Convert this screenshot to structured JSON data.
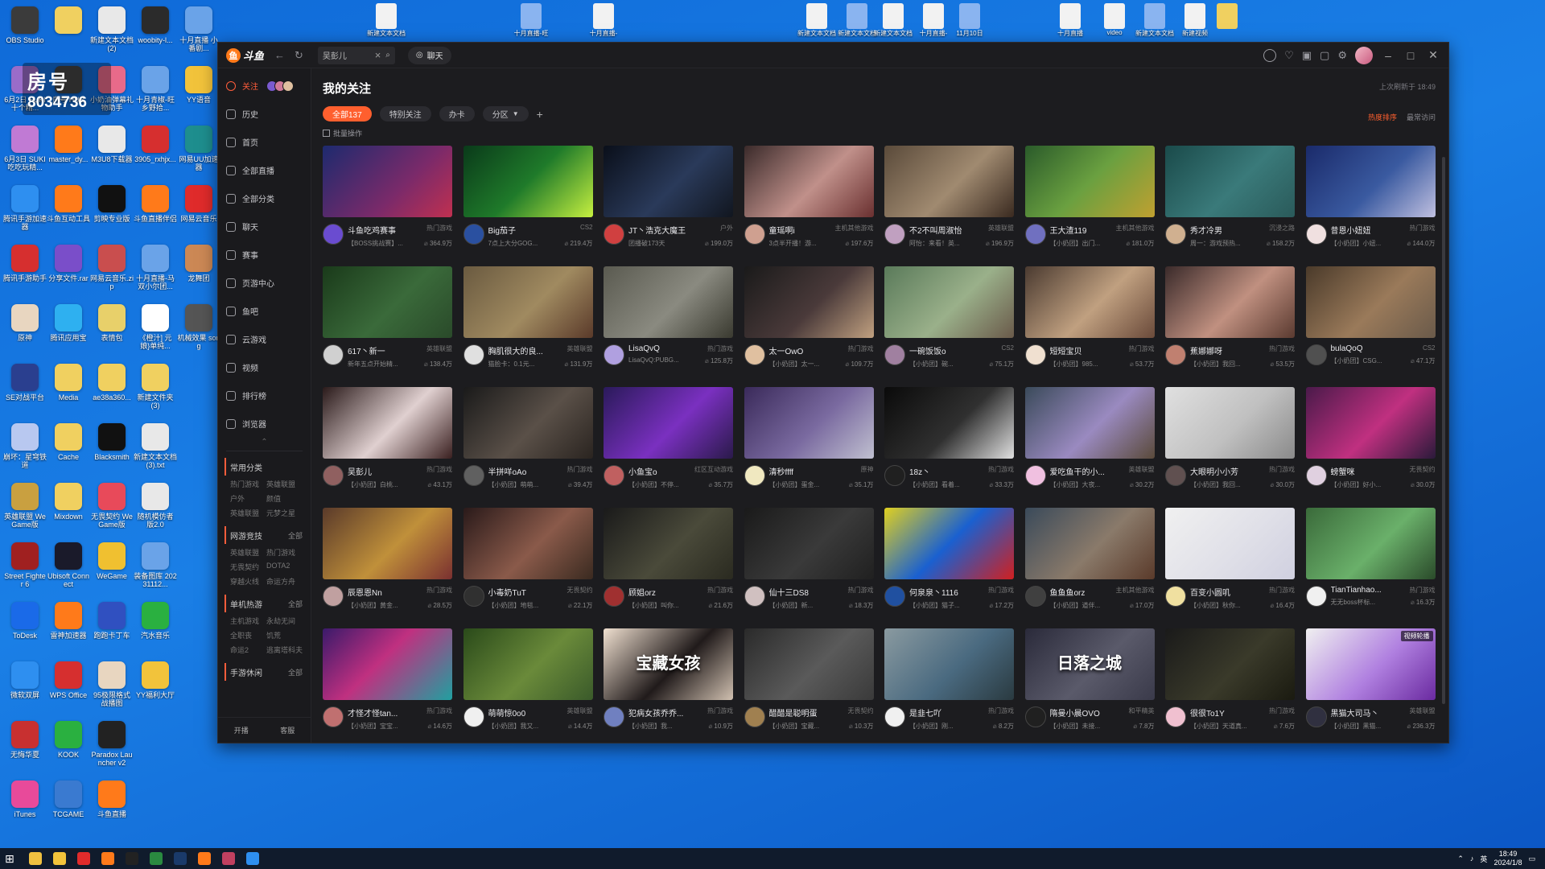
{
  "watermark": {
    "title": "房号",
    "number": "8034736"
  },
  "desktop_icons": [
    {
      "label": "OBS Studio",
      "color": "#3b3b3b"
    },
    {
      "label": "",
      "color": "#f0d060"
    },
    {
      "label": "新建文本文档 (2)",
      "color": "#e8e8e8"
    },
    {
      "label": "woobity-l...",
      "color": "#2b2b2b"
    },
    {
      "label": "十月直播 小番剧...",
      "color": "#6aa3e8"
    },
    {
      "label": "6月2日 SUKI十个精...",
      "color": "#9a6cc9"
    },
    {
      "label": "房号 HUB",
      "color": "#444"
    },
    {
      "label": "小奶油弹幕礼物助手",
      "color": "#e86a8a"
    },
    {
      "label": "十月青椒-旺 乡野拾...",
      "color": "#6aa3e8"
    },
    {
      "label": "YY语音",
      "color": "#f2c33b"
    },
    {
      "label": "6月3日 SUKI 吃吃玩精...",
      "color": "#c07ad4"
    },
    {
      "label": "master_dy...",
      "color": "#ff7a1a"
    },
    {
      "label": "M3U8下载器",
      "color": "#e8e8e8"
    },
    {
      "label": "3905_rxhjx...",
      "color": "#d62f2f"
    },
    {
      "label": "网易UU加速器",
      "color": "#1e8e8e"
    },
    {
      "label": "腾讯手游加速器",
      "color": "#2e8ff0"
    },
    {
      "label": "斗鱼互动工具",
      "color": "#ff7a1a"
    },
    {
      "label": "剪映专业版",
      "color": "#111"
    },
    {
      "label": "斗鱼直播伴侣",
      "color": "#ff7a1a"
    },
    {
      "label": "网易云音乐",
      "color": "#e02b2b"
    },
    {
      "label": "腾讯手游助手",
      "color": "#d62f2f"
    },
    {
      "label": "分享文件.rar",
      "color": "#7a4ec9"
    },
    {
      "label": "网易云音乐.zip",
      "color": "#c94e4e"
    },
    {
      "label": "十月直播-马双小尔团...",
      "color": "#6aa3e8"
    },
    {
      "label": "龙舞团",
      "color": "#cc8855"
    },
    {
      "label": "原神",
      "color": "#e8d6c0"
    },
    {
      "label": "腾讯应用宝",
      "color": "#2eb0f0"
    },
    {
      "label": "表情包",
      "color": "#e8d06a"
    },
    {
      "label": "《橙汁] 元 娘}单纯...",
      "color": "#fff"
    },
    {
      "label": "机械效果 song",
      "color": "#555"
    },
    {
      "label": "SE对战平台",
      "color": "#2a3f8f"
    },
    {
      "label": "Media",
      "color": "#f0d060"
    },
    {
      "label": "ae38a360...",
      "color": "#f0d060"
    },
    {
      "label": "新建文件夹 (3)",
      "color": "#f0d060"
    },
    {
      "label": "",
      "color": "transparent"
    },
    {
      "label": "崩坏：星穹铁道",
      "color": "#b8c8f0"
    },
    {
      "label": "Cache",
      "color": "#f0d060"
    },
    {
      "label": "Blacksmith",
      "color": "#111"
    },
    {
      "label": "新建文本文档 (3).txt",
      "color": "#e8e8e8"
    },
    {
      "label": "",
      "color": "transparent"
    },
    {
      "label": "英雄联盟 WeGame版",
      "color": "#c9a040"
    },
    {
      "label": "Mixdown",
      "color": "#f0d060"
    },
    {
      "label": "无畏契约 WeGame版",
      "color": "#e84a5a"
    },
    {
      "label": "随机模仿者 版2.0",
      "color": "#e8e8e8"
    },
    {
      "label": "",
      "color": "transparent"
    },
    {
      "label": "Street Fighter 6",
      "color": "#a02020"
    },
    {
      "label": "Ubisoft Connect",
      "color": "#1a1a2a"
    },
    {
      "label": "WeGame",
      "color": "#f0c030"
    },
    {
      "label": "装备图库 20231112...",
      "color": "#6aa3e8"
    },
    {
      "label": "",
      "color": "transparent"
    },
    {
      "label": "ToDesk",
      "color": "#1a6ae8"
    },
    {
      "label": "雷神加速器",
      "color": "#ff7a1a"
    },
    {
      "label": "跑跑卡丁车",
      "color": "#3050c0"
    },
    {
      "label": "汽水音乐",
      "color": "#2ab040"
    },
    {
      "label": "",
      "color": "transparent"
    },
    {
      "label": "微软双屏",
      "color": "#2e8ff0"
    },
    {
      "label": "WPS Office",
      "color": "#d62f2f"
    },
    {
      "label": "95极限格式战播图",
      "color": "#e8d6c0"
    },
    {
      "label": "YY福利大厅",
      "color": "#f2c33b"
    },
    {
      "label": "",
      "color": "transparent"
    },
    {
      "label": "无悔华夏",
      "color": "#c83030"
    },
    {
      "label": "KOOK",
      "color": "#2ab040"
    },
    {
      "label": "Paradox Launcher v2",
      "color": "#222"
    },
    {
      "label": "",
      "color": "transparent"
    },
    {
      "label": "",
      "color": "transparent"
    },
    {
      "label": "iTunes",
      "color": "#e84a9a"
    },
    {
      "label": "TCGAME",
      "color": "#3a7ad0"
    },
    {
      "label": "斗鱼直播",
      "color": "#ff7a1a"
    }
  ],
  "desktop_top_icons": [
    {
      "label": "新建文本文档"
    },
    {
      "label": "十月直播-旺"
    },
    {
      "label": "十月直播-"
    },
    {
      "label": "新建文本文档"
    },
    {
      "label": "新建文本文档"
    },
    {
      "label": "新建文本文档"
    },
    {
      "label": "十月直播-"
    },
    {
      "label": "11月10日"
    },
    {
      "label": "十月直播"
    },
    {
      "label": "video"
    },
    {
      "label": "新建文本文档"
    },
    {
      "label": "新建视频"
    },
    {
      "label": ""
    }
  ],
  "app": {
    "logo_text": "斗鱼",
    "search_value": "吴彭儿",
    "chat_label": "聊天",
    "page_title": "我的关注",
    "last_refresh": "上次刷新于 18:49",
    "batch_label": "批量操作",
    "sort_hot": "热度排序",
    "sort_recent": "最常访问",
    "filters": [
      {
        "label": "全部137",
        "active": true
      },
      {
        "label": "特别关注",
        "active": false
      },
      {
        "label": "办卡",
        "active": false
      },
      {
        "label": "分区",
        "active": false,
        "caret": true
      }
    ]
  },
  "sidebar": {
    "items": [
      {
        "label": "关注",
        "active": true
      },
      {
        "label": "历史"
      },
      {
        "label": "首页"
      },
      {
        "label": "全部直播"
      },
      {
        "label": "全部分类"
      },
      {
        "label": "聊天"
      },
      {
        "label": "赛事"
      },
      {
        "label": "页游中心"
      },
      {
        "label": "鱼吧"
      },
      {
        "label": "云游戏"
      },
      {
        "label": "视频"
      },
      {
        "label": "排行榜"
      },
      {
        "label": "浏览器"
      }
    ],
    "sections": [
      {
        "title": "常用分类",
        "more": "",
        "subs": [
          "热门游戏",
          "英雄联盟",
          "户外",
          "颜值",
          "英雄联盟",
          "元梦之星"
        ]
      },
      {
        "title": "网游竞技",
        "more": "全部",
        "subs": [
          "英雄联盟",
          "热门游戏",
          "无畏契约",
          "DOTA2",
          "穿越火线",
          "命运方舟"
        ]
      },
      {
        "title": "单机热游",
        "more": "全部",
        "subs": [
          "主机游戏",
          "永劫无间",
          "全职丧",
          "饥荒",
          "命运2",
          "逃离塔科夫"
        ]
      },
      {
        "title": "手游休闲",
        "more": "全部",
        "subs": []
      }
    ],
    "bottom_left": "开播",
    "bottom_right": "客服"
  },
  "cards": [
    {
      "name": "斗鱼吃鸡赛事",
      "cat": "热门游戏",
      "desc": "【BOSS挑战赛】...",
      "views": "364.9万",
      "bg": "linear-gradient(135deg,#1d2a6e,#7a2a6a 60%,#c03050)",
      "av": "#6a4cd0"
    },
    {
      "name": "Big茄子",
      "cat": "CS2",
      "desc": "7点上大分GOG...",
      "views": "219.4万",
      "bg": "linear-gradient(135deg,#0a3a1a,#1f7a2a 50%,#c6f040)",
      "av": "#2a50a0"
    },
    {
      "name": "JT丶浩克大魔王",
      "cat": "户外",
      "desc": "团播破173天",
      "views": "199.0万",
      "bg": "linear-gradient(135deg,#0a0f1a,#2a3a5a 55%,#11161f)",
      "av": "#d04040"
    },
    {
      "name": "童瑶啊i",
      "cat": "主机其他游戏",
      "desc": "3点半开播！游...",
      "views": "197.6万",
      "bg": "linear-gradient(135deg,#3a2a2a,#c0908a 55%,#6a3030)",
      "av": "#cfa090"
    },
    {
      "name": "不2不叫周淑怡",
      "cat": "英雄联盟",
      "desc": "阿怡：来看！英...",
      "views": "196.9万",
      "bg": "linear-gradient(135deg,#5a4a3a,#a08a70 55%,#3a2a20)",
      "av": "#c0a0c0"
    },
    {
      "name": "王大渣119",
      "cat": "主机其他游戏",
      "desc": "【小奶团】出门...",
      "views": "181.0万",
      "bg": "linear-gradient(135deg,#2a5a2a,#6aa040 50%,#c0a030)",
      "av": "#7070c0"
    },
    {
      "name": "秀才冷男",
      "cat": "沉浸之路",
      "desc": "周一：游戏预热...",
      "views": "158.2万",
      "bg": "linear-gradient(135deg,#1a4a4a,#3a7a7a 55%,#2a5a5a)",
      "av": "#d0b090"
    },
    {
      "name": "昔恩小妞妞",
      "cat": "热门游戏",
      "desc": "【小奶团】小妞...",
      "views": "144.0万",
      "bg": "linear-gradient(135deg,#1a2a6a,#3a5aa0 55%,#c0c0e0)",
      "av": "#f0e0e0"
    },
    {
      "name": "617丶新一",
      "cat": "英雄联盟",
      "desc": "新年五点开始精...",
      "views": "138.4万",
      "bg": "linear-gradient(135deg,#1a3a1a,#3a6a3a 55%,#2a4a2a)",
      "av": "#d0d0d0"
    },
    {
      "name": "胸肌很大的良...",
      "cat": "英雄联盟",
      "desc": "猫脸卡：0.1元...",
      "views": "131.9万",
      "bg": "linear-gradient(135deg,#6a5a40,#a08a60 55%,#5a3a2a)",
      "av": "#e0e0e0"
    },
    {
      "name": "LisaQvQ",
      "cat": "热门游戏",
      "desc": "LisaQvQ:PUBG...",
      "views": "125.8万",
      "bg": "linear-gradient(135deg,#5a5a50,#8a8a80 55%,#3a3a30)",
      "av": "#b0a0e0"
    },
    {
      "name": "太一OwO",
      "cat": "热门游戏",
      "desc": "【小奶团】太一...",
      "views": "109.7万",
      "bg": "linear-gradient(135deg,#1a1a1a,#4a3a3a 55%,#c0a080)",
      "av": "#e0c0a0"
    },
    {
      "name": "一碗饭饭o",
      "cat": "CS2",
      "desc": "【小奶团】碗...",
      "views": "75.1万",
      "bg": "linear-gradient(135deg,#5a7a5a,#9ab08a 55%,#6a5a4a)",
      "av": "#a080a0"
    },
    {
      "name": "短短宝贝",
      "cat": "热门游戏",
      "desc": "【小奶团】985...",
      "views": "53.7万",
      "bg": "linear-gradient(135deg,#4a3a30,#c0a080 55%,#6a4a3a)",
      "av": "#f0e0d0"
    },
    {
      "name": "蕉娜娜呀",
      "cat": "热门游戏",
      "desc": "【小奶团】我回...",
      "views": "53.5万",
      "bg": "linear-gradient(135deg,#3a2a2a,#c09080 55%,#5a3a30)",
      "av": "#c08070"
    },
    {
      "name": "bulaQoQ",
      "cat": "CS2",
      "desc": "【小奶团】CSG...",
      "views": "47.1万",
      "bg": "linear-gradient(135deg,#4a3a2a,#9a7a5a 55%,#6a5a4a)",
      "av": "#505050"
    },
    {
      "name": "吴彭儿",
      "cat": "热门游戏",
      "desc": "【小奶团】白桃...",
      "views": "43.1万",
      "bg": "linear-gradient(135deg,#2a1a1a,#e0d0d0 55%,#3a2020)",
      "av": "#906060"
    },
    {
      "name": "半拼咩oAo",
      "cat": "热门游戏",
      "desc": "【小奶团】萌萌...",
      "views": "39.4万",
      "bg": "linear-gradient(135deg,#1a1a1a,#5a5048 55%,#2a2420)",
      "av": "#606060"
    },
    {
      "name": "小鱼宝o",
      "cat": "红区互动游戏",
      "desc": "【小奶团】不停...",
      "views": "35.7万",
      "bg": "linear-gradient(135deg,#2a1a5a,#7a30c0 55%,#2a1a4a)",
      "av": "#c06060"
    },
    {
      "name": "清秒ffff",
      "cat": "原神",
      "desc": "【小奶团】蛋金...",
      "views": "35.1万",
      "bg": "linear-gradient(135deg,#3a2a5a,#7a6aa0 55%,#c0c0d0)",
      "av": "#f0e8c0"
    },
    {
      "name": "18z丶",
      "cat": "热门游戏",
      "desc": "【小奶团】看着...",
      "views": "33.3万",
      "bg": "linear-gradient(135deg,#0a0a0a,#303030 55%,#e0e0e0)",
      "av": "#202020"
    },
    {
      "name": "爱吃鱼干的小...",
      "cat": "英雄联盟",
      "desc": "【小奶团】大夜...",
      "views": "30.2万",
      "bg": "linear-gradient(135deg,#3a4a5a,#9a8ac0 55%,#5a4a3a)",
      "av": "#f0c0e0"
    },
    {
      "name": "大眼明小小芳",
      "cat": "热门游戏",
      "desc": "【小奶团】我回...",
      "views": "30.0万",
      "bg": "linear-gradient(135deg,#e0e0e0,#c0c0c0 55%,#8a8a8a)",
      "av": "#605050"
    },
    {
      "name": "螃蟹咪",
      "cat": "无畏契约",
      "desc": "【小奶团】好小...",
      "views": "30.0万",
      "bg": "linear-gradient(135deg,#4a1a4a,#c03080 55%,#2a1a3a)",
      "av": "#e0d0e0"
    },
    {
      "name": "辰恩恩Nn",
      "cat": "热门游戏",
      "desc": "【小奶团】黄金...",
      "views": "28.5万",
      "bg": "linear-gradient(135deg,#5a3a2a,#c0903a 55%,#7a3030)",
      "av": "#c0a0a0"
    },
    {
      "name": "小毒奶TuT",
      "cat": "无畏契约",
      "desc": "【小奶团】地毯...",
      "views": "22.1万",
      "bg": "linear-gradient(135deg,#2a1a1a,#8a5a4a 55%,#3a2a20)",
      "av": "#303030"
    },
    {
      "name": "顾姐orz",
      "cat": "热门游戏",
      "desc": "【小奶团】叫你...",
      "views": "21.6万",
      "bg": "linear-gradient(135deg,#1a1a1a,#4a4a3a 55%,#2a2a20)",
      "av": "#a03030"
    },
    {
      "name": "仙十三DS8",
      "cat": "热门游戏",
      "desc": "【小奶团】新...",
      "views": "18.3万",
      "bg": "linear-gradient(135deg,#1a1a1a,#3a3a3a 55%,#202020)",
      "av": "#d0c0c0"
    },
    {
      "name": "何泉泉丶1116",
      "cat": "热门游戏",
      "desc": "【小奶团】猫子...",
      "views": "17.2万",
      "bg": "linear-gradient(135deg,#e0d020,#1a60d0 50%,#d02020)",
      "av": "#2050a0"
    },
    {
      "name": "鱼鱼鱼orz",
      "cat": "主机其他游戏",
      "desc": "【小奶团】道伴...",
      "views": "17.0万",
      "bg": "linear-gradient(135deg,#3a4a5a,#8a7a6a 55%,#5a3a2a)",
      "av": "#404040"
    },
    {
      "name": "百变小圆叽",
      "cat": "热门游戏",
      "desc": "【小奶团】秋你...",
      "views": "16.4万",
      "bg": "linear-gradient(135deg,#f0f0f0,#e0e0e8 55%,#d0d0e0)",
      "av": "#f0e0a0"
    },
    {
      "name": "TianTianhao...",
      "cat": "热门游戏",
      "desc": "无无boss杯标...",
      "views": "16.3万",
      "bg": "linear-gradient(135deg,#3a6a3a,#6ab06a 55%,#2a4a2a)",
      "av": "#f0f0f0"
    },
    {
      "name": "才怪才怪tan...",
      "cat": "热门游戏",
      "desc": "【小奶团】宝宝...",
      "views": "14.6万",
      "bg": "linear-gradient(135deg,#3a1a6a,#c03080 45%,#20a0a0)",
      "av": "#c07070"
    },
    {
      "name": "萌萌惊0o0",
      "cat": "英雄联盟",
      "desc": "【小奶团】我又...",
      "views": "14.4万",
      "bg": "linear-gradient(135deg,#2a4a1a,#6a8a3a 55%,#3a5a2a)",
      "av": "#f0f0f0"
    },
    {
      "name": "犯病女孩乔乔...",
      "cat": "热门游戏",
      "desc": "【小奶团】我...",
      "views": "10.9万",
      "bg": "linear-gradient(135deg,#f0e0d0,#201a1a 55%,#d0c0b0)",
      "av": "#7080c0",
      "overlay": "宝藏女孩"
    },
    {
      "name": "醋醋是聪明蛋",
      "cat": "无畏契约",
      "desc": "【小奶团】宝藏...",
      "views": "10.3万",
      "bg": "linear-gradient(135deg,#2a2a2a,#5a5a5a 55%,#3a3a3a)",
      "av": "#a08050"
    },
    {
      "name": "是韭七吖",
      "cat": "热门游戏",
      "desc": "【小奶团】刚...",
      "views": "8.2万",
      "bg": "linear-gradient(135deg,#8a9aa0,#4a6a80 55%,#2a3a40)",
      "av": "#f0f0f0"
    },
    {
      "name": "隋曼小晨OVO",
      "cat": "和平精英",
      "desc": "【小奶团】未接...",
      "views": "7.8万",
      "bg": "linear-gradient(135deg,#2a2a3a,#5a5a6a 55%,#3a3a4a)",
      "av": "#202020",
      "overlay": "日落之城"
    },
    {
      "name": "很很To1Y",
      "cat": "热门游戏",
      "desc": "【小奶团】天道真...",
      "views": "7.6万",
      "bg": "linear-gradient(135deg,#1a1a1a,#3a3a2a 55%,#1a1a10)",
      "av": "#f0c0d0"
    },
    {
      "name": "黑猫大司马丶",
      "cat": "英雄联盟",
      "desc": "【小奶团】黑猫...",
      "views": "236.3万",
      "bg": "linear-gradient(135deg,#f0f0f0,#b080e0 55%,#6a2aa0)",
      "av": "#303040",
      "tag": "视频轮播"
    }
  ],
  "taskbar": {
    "time": "18:49",
    "date": "2024/1/8",
    "ime": "英"
  }
}
